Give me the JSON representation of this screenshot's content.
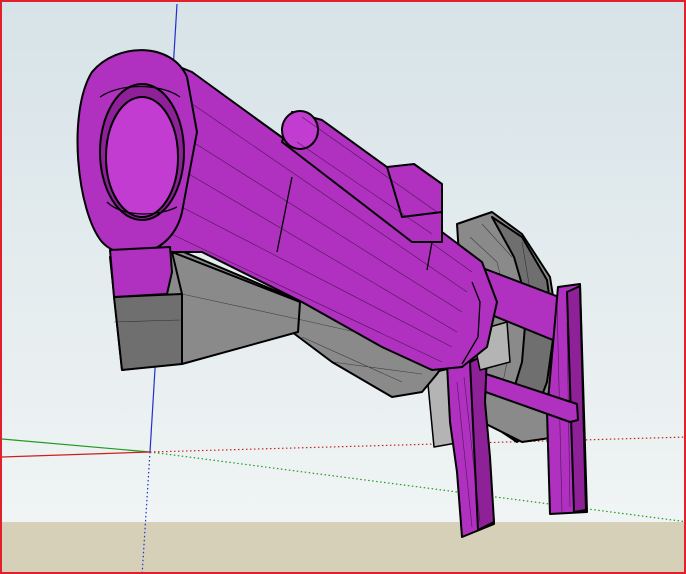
{
  "viewport": {
    "frame_color": "#e0202a",
    "sky_top": "#d9e5ea",
    "sky_bottom": "#eef3f4",
    "ground_color": "#d6d0b8"
  },
  "axes": {
    "red": "#cc2020",
    "green": "#209a20",
    "blue": "#2030cc"
  },
  "model": {
    "primary_color": "#b030c0",
    "secondary_color": "#8a8a8a"
  }
}
